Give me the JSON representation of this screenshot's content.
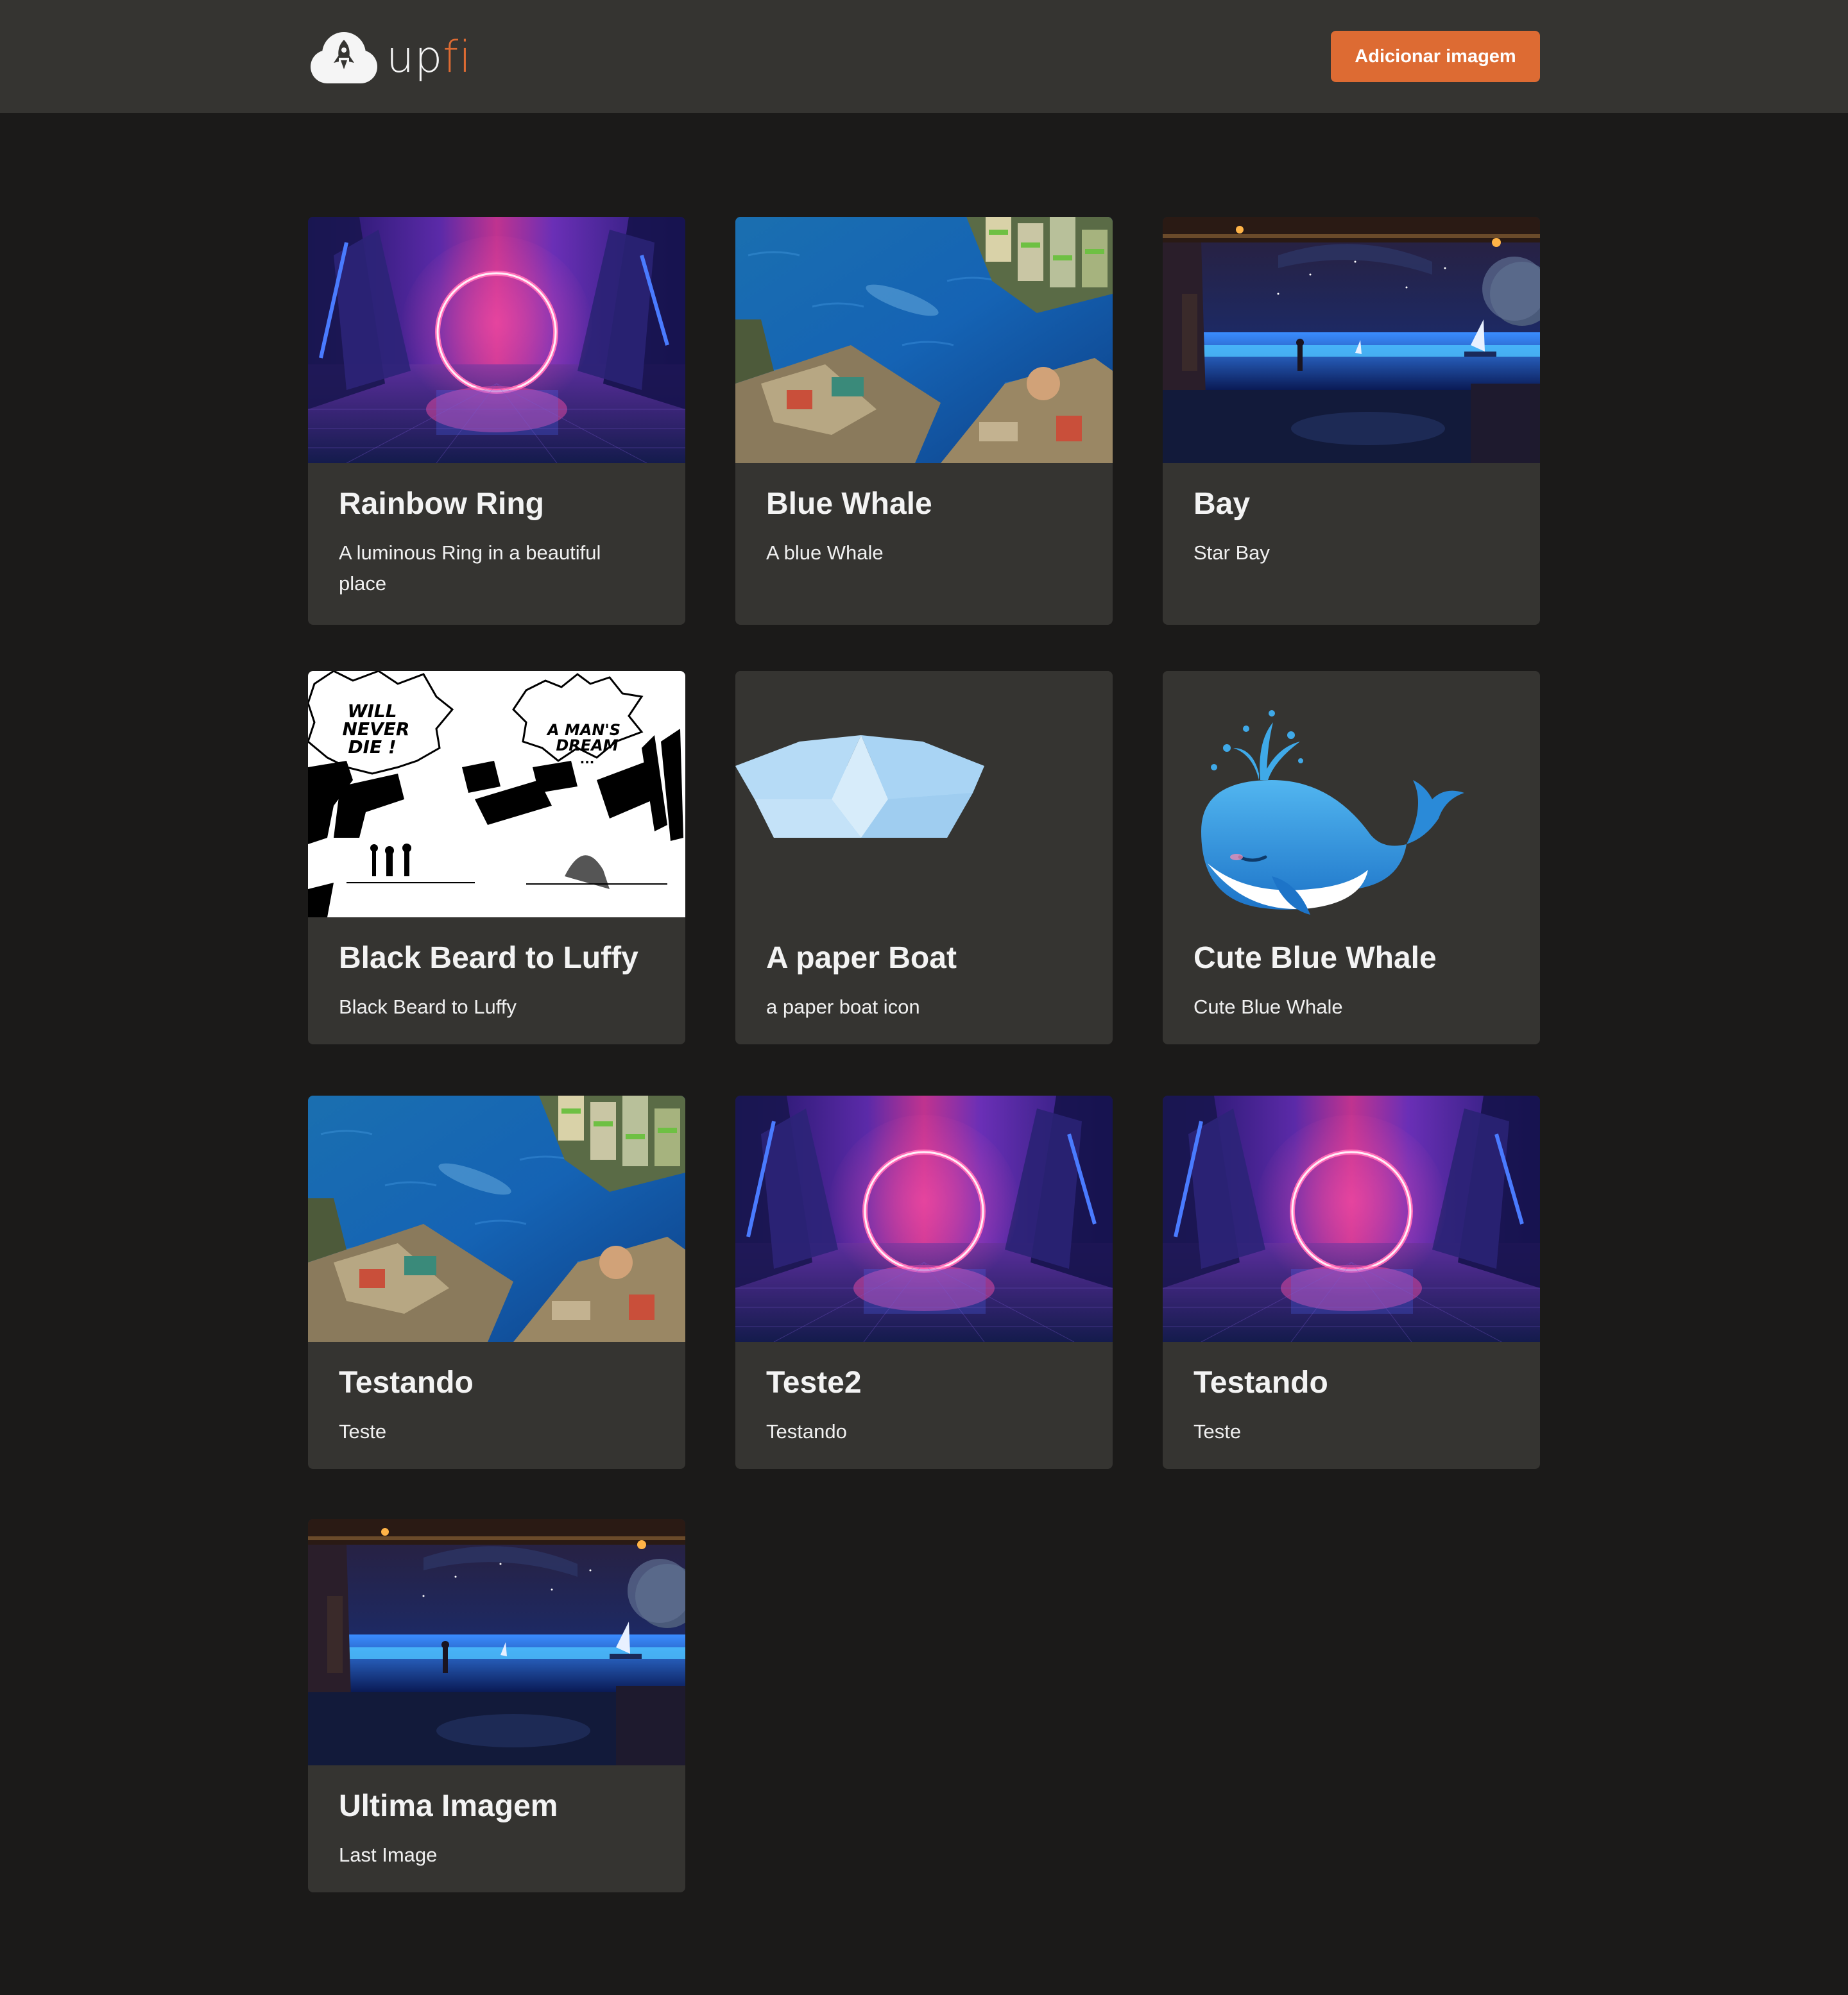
{
  "header": {
    "logo": {
      "part1": "up",
      "part2": "fi",
      "icon": "rocket-cloud-icon"
    },
    "add_button_label": "Adicionar imagem"
  },
  "colors": {
    "accent": "#dd6b33",
    "page_background": "#1b1a19",
    "card_background": "#353431",
    "header_background": "#353431"
  },
  "cards": [
    {
      "title": "Rainbow Ring",
      "description": "A luminous Ring in a beautiful place",
      "image": "neon-ring-image"
    },
    {
      "title": "Blue Whale",
      "description": "A blue Whale",
      "image": "blue-whale-city-image"
    },
    {
      "title": "Bay",
      "description": "Star Bay",
      "image": "star-bay-image"
    },
    {
      "title": "Black Beard to Luffy",
      "description": "Black Beard to Luffy",
      "image": "manga-panel-image",
      "manga": {
        "bubble1": "WILL NEVER DIE !",
        "bubble2": "A MAN'S DREAM ..."
      }
    },
    {
      "title": "A paper Boat",
      "description": "a paper boat icon",
      "image": "paper-boat-icon"
    },
    {
      "title": "Cute Blue Whale",
      "description": "Cute Blue Whale",
      "image": "cute-whale-icon"
    },
    {
      "title": "Testando",
      "description": "Teste",
      "image": "blue-whale-city-image"
    },
    {
      "title": "Teste2",
      "description": "Testando",
      "image": "neon-ring-image"
    },
    {
      "title": "Testando",
      "description": "Teste",
      "image": "neon-ring-image"
    },
    {
      "title": "Ultima Imagem",
      "description": "Last Image",
      "image": "star-bay-image"
    }
  ]
}
